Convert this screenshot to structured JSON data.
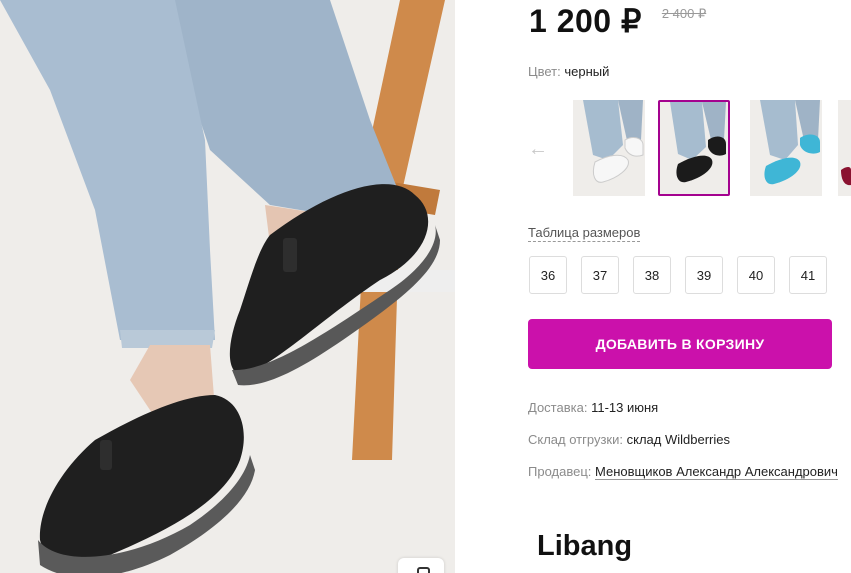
{
  "product": {
    "price": "1 200 ₽",
    "old_price": "2 400 ₽",
    "color_label": "Цвет:",
    "color_value": "черный",
    "brand": "Libang"
  },
  "gallery": {
    "prev_arrow": "←",
    "thumbnails": [
      {
        "name": "white shoes",
        "color": "#f2f2f2"
      },
      {
        "name": "black shoes",
        "color": "#1b1b1b",
        "selected": true
      },
      {
        "name": "turquoise shoes",
        "color": "#3fb6d6"
      },
      {
        "name": "burgundy shoes",
        "color": "#8a1230"
      }
    ]
  },
  "sizes": {
    "table_link": "Таблица размеров",
    "options": [
      "36",
      "37",
      "38",
      "39",
      "40",
      "41"
    ]
  },
  "cart": {
    "add_label": "ДОБАВИТЬ В КОРЗИНУ",
    "accent_color": "#cb11ab"
  },
  "delivery": {
    "label": "Доставка:",
    "value": "11-13 июня"
  },
  "warehouse": {
    "label": "Склад отгрузки:",
    "value": "склад Wildberries"
  },
  "seller": {
    "label": "Продавец:",
    "value": "Меновщиков Александр Александрович"
  }
}
